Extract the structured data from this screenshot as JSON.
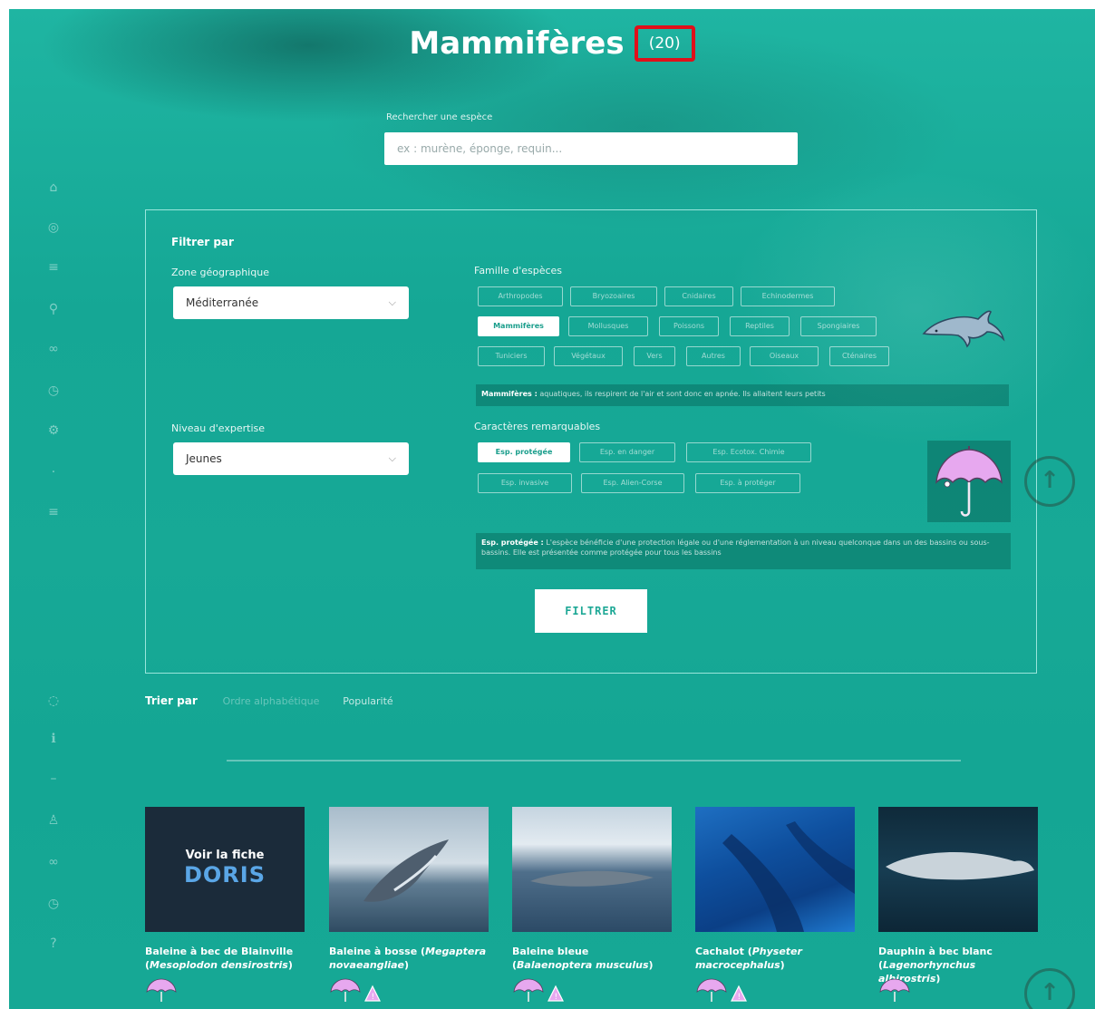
{
  "header": {
    "title": "Mammifères",
    "count": "(20)"
  },
  "search": {
    "label": "Rechercher une espèce",
    "placeholder": "ex : murène, éponge, requin..."
  },
  "filters": {
    "heading": "Filtrer par",
    "zone_label": "Zone géographique",
    "zone_value": "Méditerranée",
    "level_label": "Niveau d'expertise",
    "level_value": "Jeunes",
    "family_label": "Famille d'espèces",
    "family_chips": [
      "Arthropodes",
      "Bryozoaires",
      "Cnidaires",
      "Echinodermes",
      "Mammifères",
      "Mollusques",
      "Poissons",
      "Reptiles",
      "Spongiaires",
      "Tuniciers",
      "Végétaux",
      "Vers",
      "Autres",
      "Oiseaux",
      "Cténaires"
    ],
    "family_desc_bold": "Mammifères :",
    "family_desc_text": "aquatiques, ils respirent de l'air et sont donc en apnée. Ils allaitent leurs petits",
    "traits_label": "Caractères remarquables",
    "trait_chips": [
      "Esp. protégée",
      "Esp. en danger",
      "Esp. Ecotox. Chimie",
      "Esp. invasive",
      "Esp. Alien-Corse",
      "Esp. à protéger"
    ],
    "trait_desc_bold": "Esp. protégée :",
    "trait_desc_text": "L'espèce bénéficie d'une protection légale ou d'une réglementation à un niveau quelconque dans un des bassins ou sous-bassins. Elle est présentée comme protégée pour tous les bassins",
    "submit_label": "FILTRER"
  },
  "sort": {
    "label": "Trier par",
    "option_1": "Ordre alphabétique",
    "option_2": "Popularité"
  },
  "cards": [
    {
      "common": "Baleine à bec de Blainville",
      "latin": "Mesoplodon densirostris",
      "thumb_text_1": "Voir la fiche",
      "thumb_text_2": "DORIS"
    },
    {
      "common": "Baleine à bosse",
      "latin": "Megaptera novaeangliae"
    },
    {
      "common": "Baleine bleue",
      "latin": "Balaenoptera musculus"
    },
    {
      "common": "Cachalot",
      "latin": "Physeter macrocephalus"
    },
    {
      "common": "Dauphin à bec blanc",
      "latin": "Lagenorhynchus albirostris"
    }
  ],
  "colors": {
    "accent": "#16a895",
    "highlight": "#e0101a",
    "umbrella": "#e7a8ef"
  }
}
